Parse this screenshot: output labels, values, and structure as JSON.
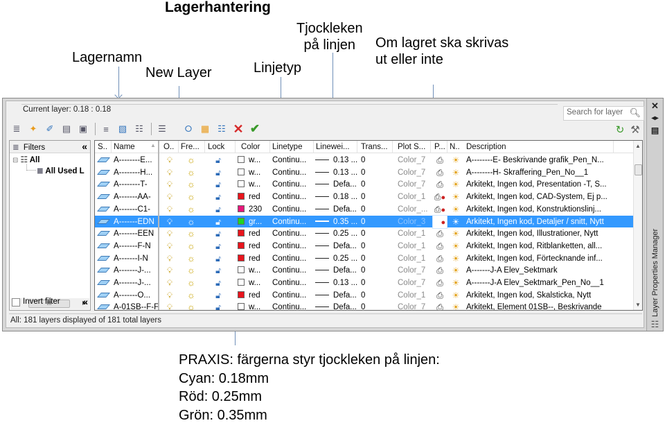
{
  "annotations": {
    "title": "Lagerhantering",
    "lagernamn": "Lagernamn",
    "new_layer": "New Layer",
    "linjetyp": "Linjetyp",
    "tjockleken_line1": "Tjockleken",
    "tjockleken_line2": "på linjen",
    "plot_line1": "Om lagret ska skrivas",
    "plot_line2": "ut eller inte",
    "praxis": [
      "PRAXIS: färgerna styr tjockleken på linjen:",
      "Cyan: 0.18mm",
      "Röd: 0.25mm",
      "Grön: 0.35mm"
    ]
  },
  "dialog": {
    "palette_title": "Layer Properties Manager",
    "current_layer": "Current layer: 0.18 : 0.18",
    "search_placeholder": "Search for layer",
    "status": "All: 181 layers displayed of 181 total layers",
    "side_buttons": [
      "close-icon",
      "auto-hide-icon",
      "properties-icon"
    ],
    "toolbar_left": [
      "new-property-filter",
      "new-group-filter",
      "layer-states-manager",
      "new-layer-state",
      "save-layer-state",
      "filter-a",
      "filter-b",
      "filter-c",
      "filter-d"
    ],
    "toolbar_layer": [
      "new-layer",
      "new-layer-vp-frozen",
      "layer-settings",
      "delete-layer",
      "set-current"
    ],
    "toolbar_right": [
      "refresh",
      "settings"
    ]
  },
  "filters": {
    "header": "Filters",
    "collapse": "«",
    "tree": [
      {
        "label": "All",
        "level": 0
      },
      {
        "label": "All Used L",
        "level": 1
      }
    ],
    "invert_label": "Invert filter",
    "invert_checked": false
  },
  "columns": [
    "S..",
    "Name",
    "O..",
    "Fre...",
    "Lock",
    "Color",
    "Linetype",
    "Linewei...",
    "Trans...",
    "Plot S...",
    "P...",
    "N..",
    "Description"
  ],
  "layers": [
    {
      "name": "A--------E...",
      "color_name": "w...",
      "color_hex": "#ffffff",
      "linetype": "Continu...",
      "lineweight": "0.13 ...",
      "transparency": "0",
      "plot_style": "Color_7",
      "plot": true,
      "description": "A--------E- Beskrivande grafik_Pen_N..."
    },
    {
      "name": "A--------H...",
      "color_name": "w...",
      "color_hex": "#ffffff",
      "linetype": "Continu...",
      "lineweight": "0.13 ...",
      "transparency": "0",
      "plot_style": "Color_7",
      "plot": true,
      "description": "A--------H- Skraffering_Pen_No__1"
    },
    {
      "name": "A--------T-",
      "color_name": "w...",
      "color_hex": "#ffffff",
      "linetype": "Continu...",
      "lineweight": "Defa...",
      "transparency": "0",
      "plot_style": "Color_7",
      "plot": true,
      "description": "Arkitekt, Ingen kod, Presentation -T, S..."
    },
    {
      "name": "A-------AA-",
      "color_name": "red",
      "color_hex": "#e8141c",
      "linetype": "Continu...",
      "lineweight": "0.18 ...",
      "transparency": "0",
      "plot_style": "Color_1",
      "plot": false,
      "description": "Arkitekt, Ingen kod, CAD-System, Ej p..."
    },
    {
      "name": "A-------C1-",
      "color_name": "230",
      "color_hex": "#e6167a",
      "linetype": "Continu...",
      "lineweight": "Defa...",
      "transparency": "0",
      "plot_style": "Color_...",
      "plot": false,
      "description": "Arkitekt, Ingen kod, Konstruktionslinj..."
    },
    {
      "name": "A-------EDN",
      "color_name": "gr...",
      "color_hex": "#22d622",
      "linetype": "Continu...",
      "lineweight": "0.35 ...",
      "transparency": "0",
      "plot_style": "Color_3",
      "plot": false,
      "description": "Arkitekt, Ingen kod, Detaljer / snitt, Nytt",
      "selected": true
    },
    {
      "name": "A-------EEN",
      "color_name": "red",
      "color_hex": "#e8141c",
      "linetype": "Continu...",
      "lineweight": "0.25 ...",
      "transparency": "0",
      "plot_style": "Color_1",
      "plot": true,
      "description": "Arkitekt, Ingen kod, Illustrationer, Nytt"
    },
    {
      "name": "A-------F-N",
      "color_name": "red",
      "color_hex": "#e8141c",
      "linetype": "Continu...",
      "lineweight": "Defa...",
      "transparency": "0",
      "plot_style": "Color_1",
      "plot": true,
      "description": "Arkitekt, Ingen kod, Ritblanketten, all..."
    },
    {
      "name": "A-------I-N",
      "color_name": "red",
      "color_hex": "#e8141c",
      "linetype": "Continu...",
      "lineweight": "0.25 ...",
      "transparency": "0",
      "plot_style": "Color_1",
      "plot": true,
      "description": "Arkitekt, Ingen kod, Förtecknande inf..."
    },
    {
      "name": "A-------J-...",
      "color_name": "w...",
      "color_hex": "#ffffff",
      "linetype": "Continu...",
      "lineweight": "Defa...",
      "transparency": "0",
      "plot_style": "Color_7",
      "plot": true,
      "description": "A-------J-A Elev_Sektmark"
    },
    {
      "name": "A-------J-...",
      "color_name": "w...",
      "color_hex": "#ffffff",
      "linetype": "Continu...",
      "lineweight": "0.13 ...",
      "transparency": "0",
      "plot_style": "Color_7",
      "plot": true,
      "description": "A-------J-A Elev_Sektmark_Pen_No__1"
    },
    {
      "name": "A-------O...",
      "color_name": "red",
      "color_hex": "#e8141c",
      "linetype": "Continu...",
      "lineweight": "Defa...",
      "transparency": "0",
      "plot_style": "Color_1",
      "plot": true,
      "description": "Arkitekt, Ingen kod, Skalsticka, Nytt"
    },
    {
      "name": "A-01SB--F-F",
      "color_name": "w...",
      "color_hex": "#ffffff",
      "linetype": "Continu...",
      "lineweight": "Defa...",
      "transparency": "0",
      "plot_style": "Color_7",
      "plot": true,
      "description": "Arkitekt, Element 01SB--, Beskrivande"
    }
  ]
}
